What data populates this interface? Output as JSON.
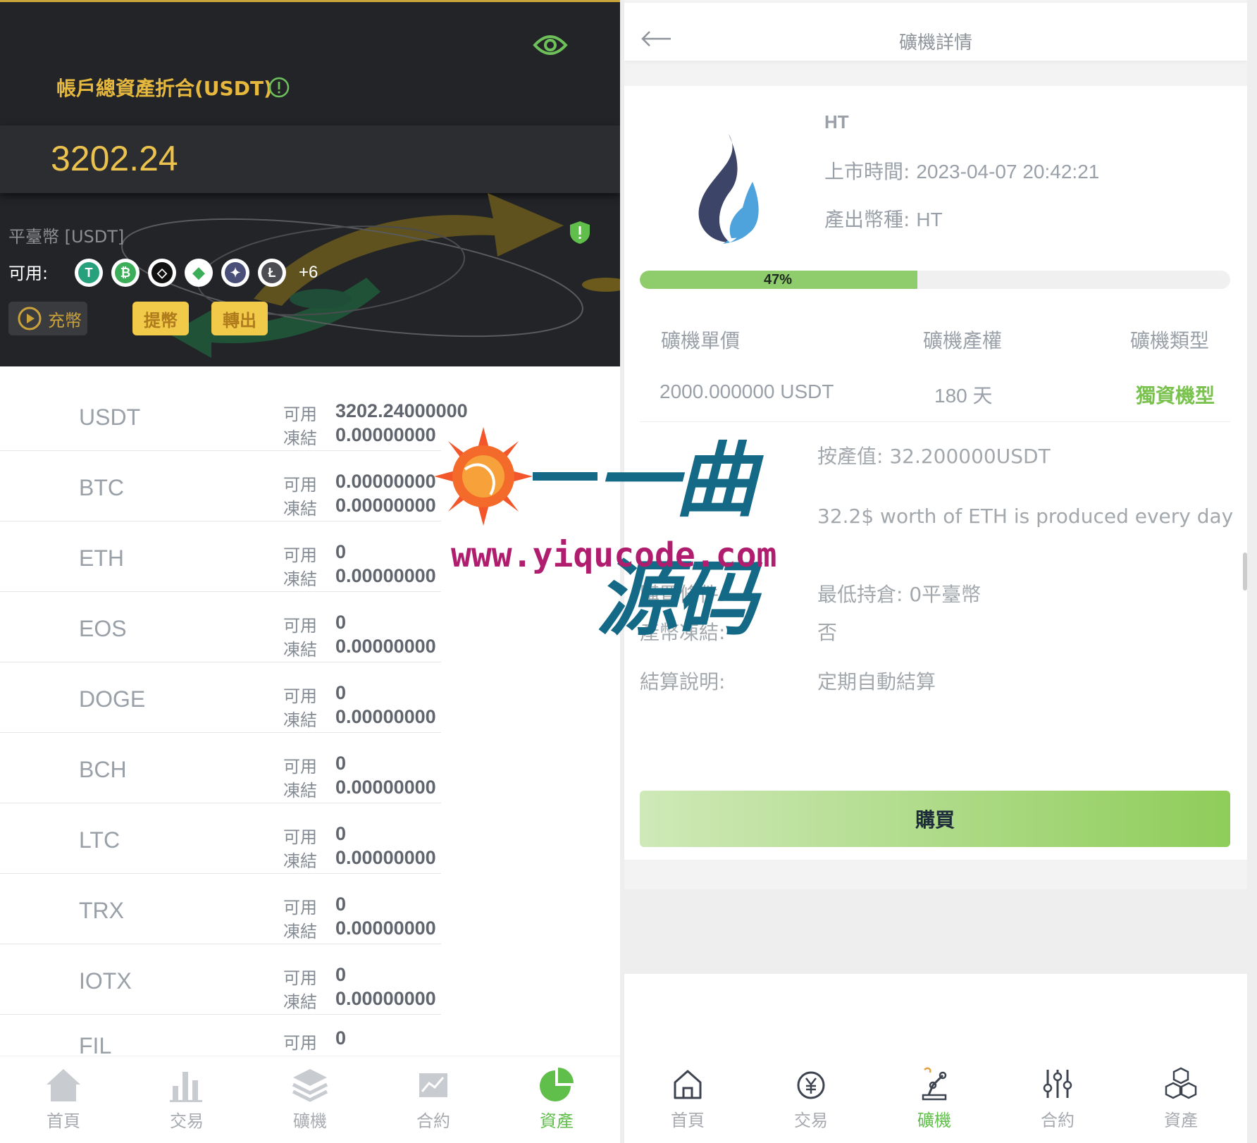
{
  "left": {
    "total_title": "帳戶總資產折合(USDT)",
    "total_amount": "3202.24",
    "platform_label": "平臺幣 [USDT]",
    "available_label": "可用:",
    "more_coins": "+6",
    "deposit_label": "充幣",
    "withdraw_label": "提幣",
    "transfer_label": "轉出",
    "available_word": "可用",
    "frozen_word": "凍結",
    "assets": [
      {
        "name": "USDT",
        "available": "3202.24000000",
        "frozen": "0.00000000"
      },
      {
        "name": "BTC",
        "available": "0.00000000",
        "frozen": "0.00000000"
      },
      {
        "name": "ETH",
        "available": "0",
        "frozen": "0.00000000"
      },
      {
        "name": "EOS",
        "available": "0",
        "frozen": "0.00000000"
      },
      {
        "name": "DOGE",
        "available": "0",
        "frozen": "0.00000000"
      },
      {
        "name": "BCH",
        "available": "0",
        "frozen": "0.00000000"
      },
      {
        "name": "LTC",
        "available": "0",
        "frozen": "0.00000000"
      },
      {
        "name": "TRX",
        "available": "0",
        "frozen": "0.00000000"
      },
      {
        "name": "IOTX",
        "available": "0",
        "frozen": "0.00000000"
      },
      {
        "name": "FIL",
        "available": "0",
        "frozen": ""
      }
    ],
    "nav": [
      {
        "label": "首頁",
        "icon": "home-icon"
      },
      {
        "label": "交易",
        "icon": "bar-chart-icon"
      },
      {
        "label": "礦機",
        "icon": "layers-icon"
      },
      {
        "label": "合約",
        "icon": "trend-icon"
      },
      {
        "label": "資產",
        "icon": "pie-icon",
        "active": true
      }
    ]
  },
  "right": {
    "title": "礦機詳情",
    "coin_name": "HT",
    "listing_label": "上市時間:",
    "listing_value": "2023-04-07 20:42:21",
    "output_label": "產出幣種:",
    "output_value": "HT",
    "progress_percent": 47,
    "progress_text": "47%",
    "table_headers": [
      "礦機單價",
      "礦機產權",
      "礦機類型"
    ],
    "table_values": [
      "2000.000000 USDT",
      "180 天",
      "獨資機型"
    ],
    "output_value_text": "按產值: 32.200000USDT",
    "description_text": "32.2$ worth of ETH is produced every day",
    "purchase_condition_label": "購買條件:",
    "purchase_condition_value": "最低持倉: 0平臺幣",
    "frozen_output_label": "產幣凍結:",
    "frozen_output_value": "否",
    "settlement_label": "結算說明:",
    "settlement_value": "定期自動結算",
    "buy_label": "購買",
    "nav": [
      {
        "label": "首頁",
        "icon": "home-outline-icon"
      },
      {
        "label": "交易",
        "icon": "yen-circle-icon"
      },
      {
        "label": "礦機",
        "icon": "robot-arm-icon",
        "active": true
      },
      {
        "label": "合約",
        "icon": "sliders-icon"
      },
      {
        "label": "資產",
        "icon": "cubes-icon"
      }
    ]
  },
  "watermark": {
    "logo_text": "一曲源码",
    "url": "www.yiqucode.com"
  },
  "colors": {
    "gold": "#e6b93e",
    "green": "#79c24d",
    "dark_header": "#232428"
  }
}
